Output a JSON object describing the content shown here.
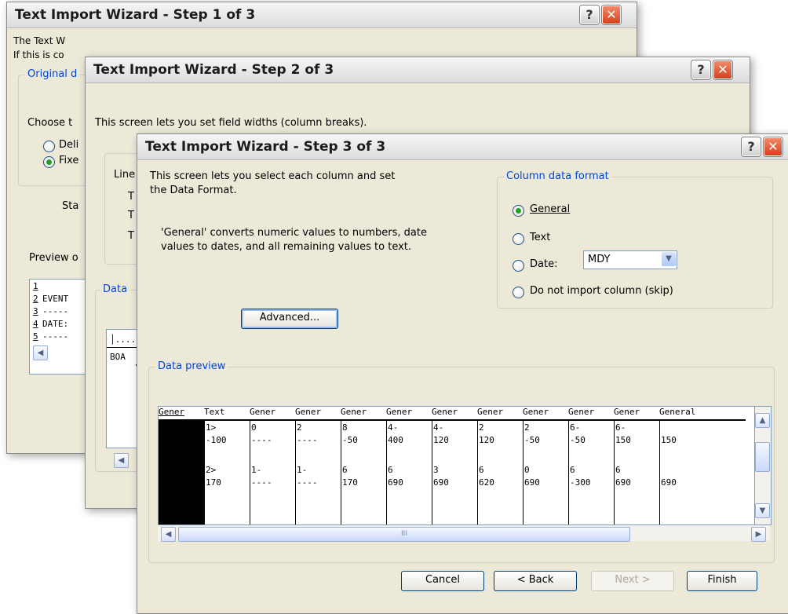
{
  "window1": {
    "title": "Text Import Wizard - Step 1 of 3",
    "intro_line1": "The Text W",
    "intro_line2": "If this is co",
    "group_legend": "Original d",
    "choose_label": "Choose t",
    "radio_delimited": "Deli",
    "radio_fixed": "Fixe",
    "start_label": "Sta",
    "preview_label": "Preview o",
    "preview_rows": [
      {
        "num": "1",
        "text": ""
      },
      {
        "num": "2",
        "text": "EVENT"
      },
      {
        "num": "3",
        "text": "-----"
      },
      {
        "num": "4",
        "text": "DATE:"
      },
      {
        "num": "5",
        "text": "-----"
      }
    ]
  },
  "window2": {
    "title": "Text Import Wizard - Step 2 of 3",
    "description": "This screen lets you set field widths (column breaks).",
    "lines_label": "Line",
    "t_letters": [
      "T",
      "T",
      "T"
    ],
    "data_label": "Data",
    "preview_line1": "BOA",
    "preview_line2": "\\"
  },
  "window3": {
    "title": "Text Import Wizard - Step 3 of 3",
    "description_line1": "This screen lets you select each column and set",
    "description_line2": "the Data Format.",
    "general_note_line1": "'General' converts numeric values to numbers, date",
    "general_note_line2": "values to dates, and all remaining values to text.",
    "advanced_button": "Advanced...",
    "column_format": {
      "legend": "Column data format",
      "options": [
        "General",
        "Text",
        "Date:",
        "Do not import column (skip)"
      ],
      "selected": "General",
      "date_format": "MDY"
    },
    "data_preview": {
      "legend": "Data preview",
      "headers": [
        "Gener",
        "Text",
        "Gener",
        "Gener",
        "Gener",
        "Gener",
        "Gener",
        "Gener",
        "Gener",
        "Gener",
        "Gener",
        "General"
      ],
      "row1_top": [
        "",
        "1>",
        "0",
        "2",
        "8",
        "4-",
        "4-",
        "2",
        "2",
        "6-",
        "6-",
        ""
      ],
      "row1_bottom": [
        "",
        "-100",
        "----",
        "----",
        "-50",
        "400",
        "120",
        "120",
        "-50",
        "-50",
        "150",
        "150"
      ],
      "row2_top": [
        "",
        "2>",
        "1-",
        "1-",
        "6",
        "6",
        "3",
        "6",
        "0",
        "6",
        "6",
        ""
      ],
      "row2_bottom": [
        "",
        "170",
        "----",
        "----",
        "170",
        "690",
        "690",
        "620",
        "690",
        "-300",
        "690",
        "690"
      ],
      "scroll_grip": "III"
    },
    "buttons": {
      "cancel": "Cancel",
      "back": "< Back",
      "next": "Next >",
      "finish": "Finish"
    }
  },
  "icons": {
    "help": "?",
    "close": "✕"
  }
}
